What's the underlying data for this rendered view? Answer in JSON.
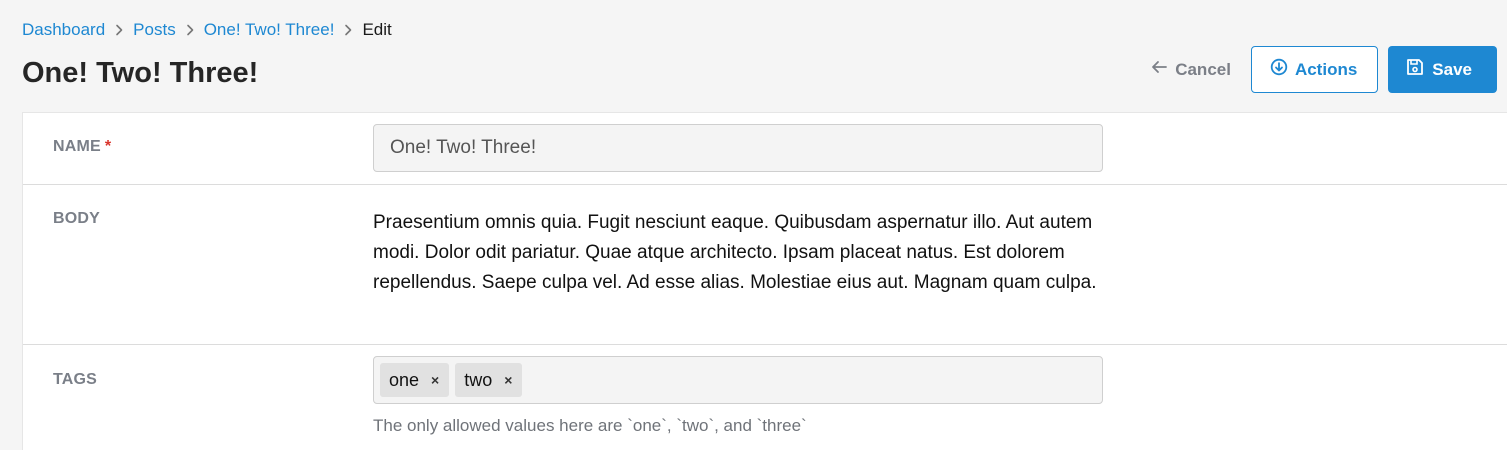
{
  "breadcrumb": {
    "items": [
      {
        "label": "Dashboard"
      },
      {
        "label": "Posts"
      },
      {
        "label": "One! Two! Three!"
      }
    ],
    "current": "Edit"
  },
  "page": {
    "title": "One! Two! Three!"
  },
  "toolbar": {
    "cancel_label": "Cancel",
    "cancel_icon": "arrow-left-icon",
    "actions_label": "Actions",
    "actions_icon": "circle-arrow-down-icon",
    "save_label": "Save",
    "save_icon": "floppy-disk-icon"
  },
  "form": {
    "name": {
      "label": "NAME",
      "required_marker": "*",
      "value": "One! Two! Three!"
    },
    "body": {
      "label": "BODY",
      "value": "Praesentium omnis quia. Fugit nesciunt eaque. Quibusdam aspernatur illo. Aut autem modi. Dolor odit pariatur. Quae atque architecto. Ipsam placeat natus. Est dolorem repellendus. Saepe culpa vel. Ad esse alias. Molestiae eius aut. Magnam quam culpa."
    },
    "tags": {
      "label": "TAGS",
      "values": [
        {
          "label": "one",
          "remove": "×"
        },
        {
          "label": "two",
          "remove": "×"
        }
      ],
      "help": "The only allowed values here are `one`, `two`, and `three`"
    }
  },
  "colors": {
    "accent": "#1e88d2",
    "required": "#d9342b",
    "background": "#f5f5f5"
  }
}
